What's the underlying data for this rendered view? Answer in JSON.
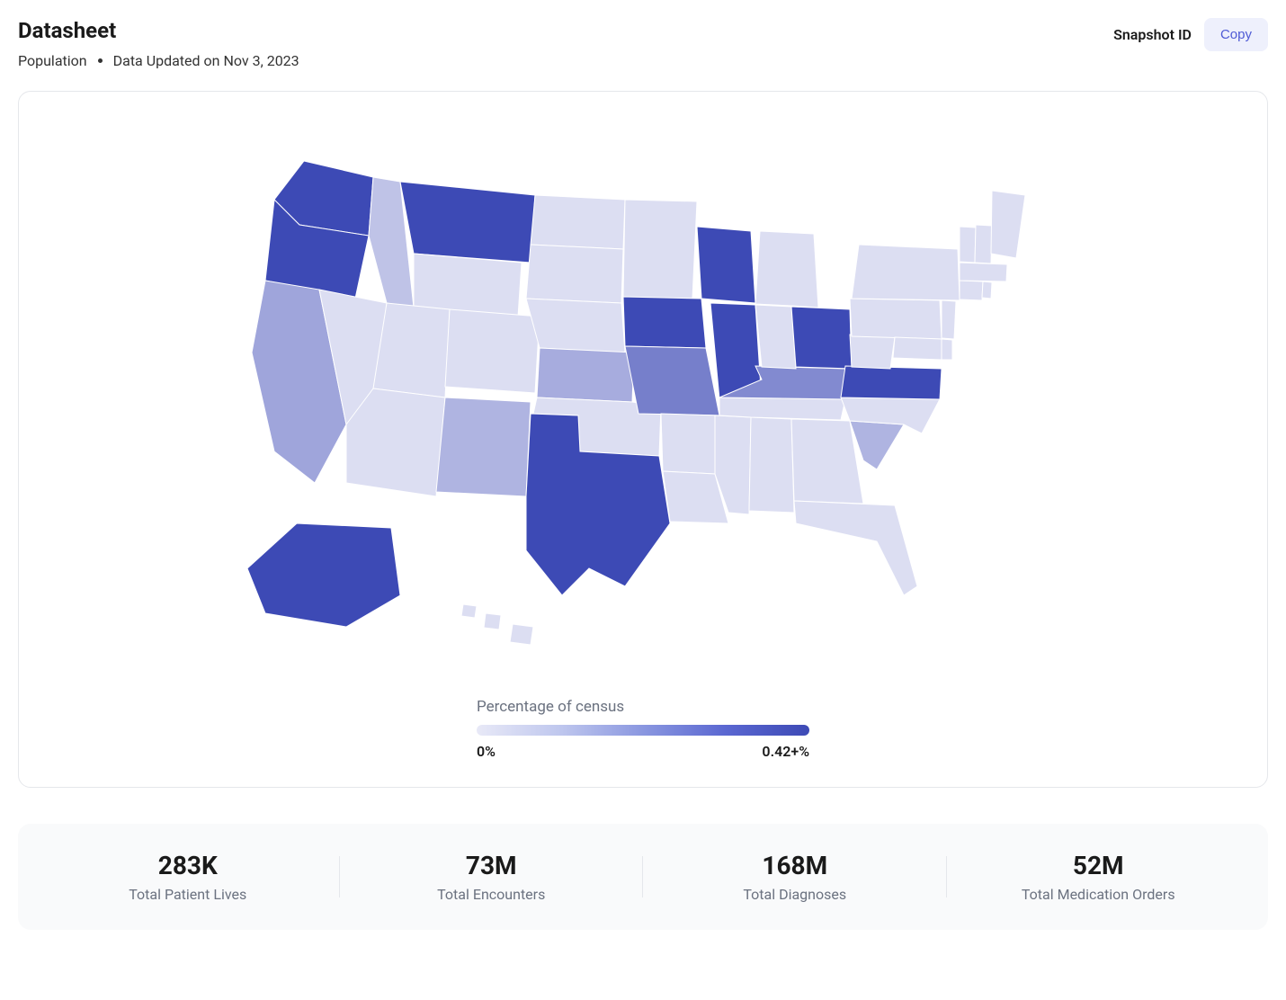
{
  "header": {
    "title": "Datasheet",
    "subtitle_left": "Population",
    "subtitle_right": "Data Updated on Nov 3, 2023",
    "snapshot_label": "Snapshot ID",
    "copy_label": "Copy"
  },
  "legend": {
    "title": "Percentage of census",
    "min_label": "0%",
    "max_label": "0.42+%"
  },
  "stats": [
    {
      "value": "283K",
      "label": "Total Patient Lives"
    },
    {
      "value": "73M",
      "label": "Total Encounters"
    },
    {
      "value": "168M",
      "label": "Total Diagnoses"
    },
    {
      "value": "52M",
      "label": "Total Medication Orders"
    }
  ],
  "chart_data": {
    "type": "heatmap",
    "title": "Percentage of census",
    "units": "percent",
    "scale_min": 0.0,
    "scale_max": 0.42,
    "color_low": "#e8e9f7",
    "color_high": "#3d4ab5",
    "note": "Values above 0.42% are clamped to the top of the scale (0.42+%). Per-state values are approximate readings from the choropleth shading.",
    "states": {
      "WA": 0.42,
      "OR": 0.42,
      "MT": 0.42,
      "TX": 0.42,
      "IL": 0.42,
      "IA": 0.42,
      "WI": 0.42,
      "OH": 0.42,
      "VA": 0.42,
      "AK": 0.42,
      "MO": 0.28,
      "KY": 0.25,
      "CA": 0.18,
      "KS": 0.16,
      "NM": 0.14,
      "SC": 0.14,
      "ID": 0.1,
      "NV": 0.03,
      "UT": 0.03,
      "AZ": 0.03,
      "CO": 0.03,
      "WY": 0.03,
      "ND": 0.03,
      "SD": 0.03,
      "NE": 0.03,
      "OK": 0.03,
      "MN": 0.03,
      "AR": 0.03,
      "LA": 0.03,
      "MS": 0.03,
      "AL": 0.03,
      "GA": 0.03,
      "FL": 0.03,
      "NC": 0.03,
      "TN": 0.03,
      "IN": 0.03,
      "MI": 0.03,
      "WV": 0.03,
      "PA": 0.03,
      "NY": 0.03,
      "MD": 0.03,
      "DE": 0.03,
      "NJ": 0.03,
      "CT": 0.03,
      "RI": 0.03,
      "MA": 0.03,
      "VT": 0.03,
      "NH": 0.03,
      "ME": 0.03,
      "HI": 0.03
    }
  }
}
